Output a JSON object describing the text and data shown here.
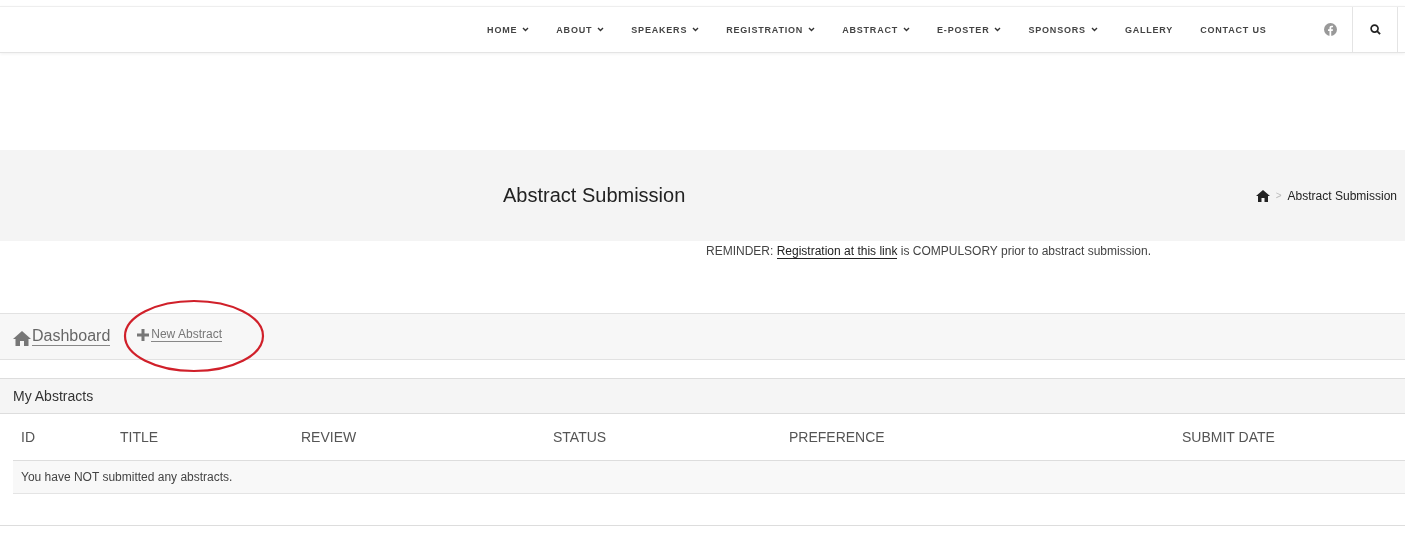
{
  "nav": {
    "items": [
      {
        "label": "HOME",
        "dropdown": true
      },
      {
        "label": "ABOUT",
        "dropdown": true
      },
      {
        "label": "SPEAKERS",
        "dropdown": true
      },
      {
        "label": "REGISTRATION",
        "dropdown": true
      },
      {
        "label": "ABSTRACT",
        "dropdown": true
      },
      {
        "label": "E-POSTER",
        "dropdown": true
      },
      {
        "label": "SPONSORS",
        "dropdown": true
      },
      {
        "label": "GALLERY",
        "dropdown": false
      },
      {
        "label": "CONTACT US",
        "dropdown": false
      }
    ]
  },
  "page_header": {
    "title": "Abstract Submission",
    "breadcrumb_separator": ">",
    "breadcrumb": "Abstract Submission"
  },
  "reminder": {
    "before": "REMINDER: ",
    "link": "Registration at this link",
    "after": " is COMPULSORY prior to abstract submission."
  },
  "toolbar": {
    "dashboard": "Dashboard",
    "new_abstract": "New Abstract"
  },
  "panel": {
    "title": "My Abstracts",
    "columns": [
      "ID",
      "TITLE",
      "REVIEW",
      "STATUS",
      "PREFERENCE",
      "SUBMIT DATE"
    ],
    "empty_message": "You have NOT submitted any abstracts."
  }
}
